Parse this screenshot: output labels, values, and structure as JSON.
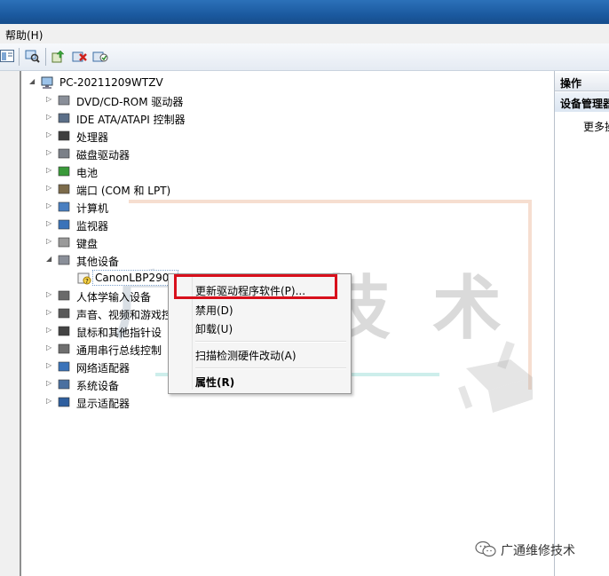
{
  "menubar": {
    "help_label": "帮助(H)"
  },
  "tree": {
    "root": "PC-20211209WTZV",
    "categories": [
      "DVD/CD-ROM 驱动器",
      "IDE ATA/ATAPI 控制器",
      "处理器",
      "磁盘驱动器",
      "电池",
      "端口 (COM 和 LPT)",
      "计算机",
      "监视器",
      "键盘",
      "其他设备",
      "人体学输入设备",
      "声音、视频和游戏控",
      "鼠标和其他指针设",
      "通用串行总线控制",
      "网络适配器",
      "系统设备",
      "显示适配器"
    ],
    "child_device": "CanonLBP2900"
  },
  "context_menu": {
    "update_driver": "更新驱动程序软件(P)...",
    "disable": "禁用(D)",
    "uninstall": "卸载(U)",
    "scan": "扫描检测硬件改动(A)",
    "properties": "属性(R)"
  },
  "actions": {
    "header": "操作",
    "section": "设备管理器",
    "more": "更多操作"
  },
  "watermark": {
    "chars": [
      "广",
      "通",
      "技",
      "术"
    ]
  },
  "footer": {
    "wechat_account": "广通维修技术"
  },
  "colors": {
    "highlight_box": "#d8101c",
    "titlebar": "#1b5aa0"
  }
}
